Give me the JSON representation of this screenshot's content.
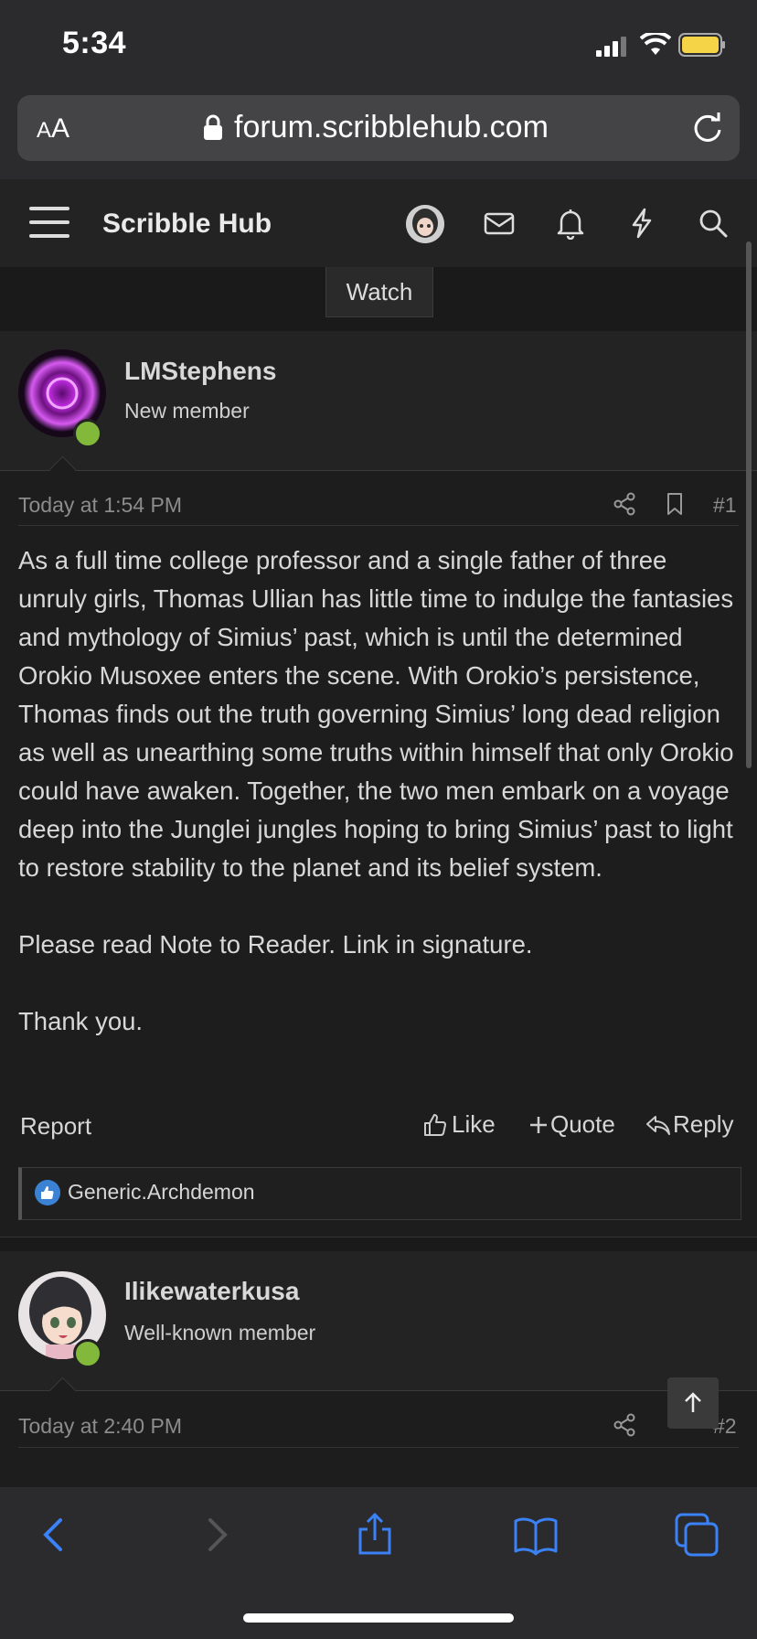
{
  "status": {
    "time": "5:34"
  },
  "browser": {
    "aa_label_small": "A",
    "aa_label_large": "A",
    "url": "forum.scribblehub.com"
  },
  "forum": {
    "site_title": "Scribble Hub",
    "watch_label": "Watch"
  },
  "posts": [
    {
      "username": "LMStephens",
      "user_title": "New member",
      "timestamp": "Today at 1:54 PM",
      "post_number": "#1",
      "body": [
        "As a full time college professor and a single father of three unruly girls, Thomas Ullian has little time to indulge the fantasies and mythology of Simius’ past, which is until the determined Orokio Musoxee enters the scene. With Orokio’s persistence, Thomas finds out the truth governing Simius’ long dead religion as well as unearthing some truths within himself that only Orokio could have awaken. Together, the two men embark on a voyage deep into the Junglei jungles hoping to bring Simius’ past to light to restore stability to the planet and its belief system.",
        "Please read Note to Reader. Link in signature.",
        "Thank you."
      ],
      "actions": {
        "report": "Report",
        "like": "Like",
        "quote": "Quote",
        "reply": "Reply"
      },
      "liked_by": "Generic.Archdemon"
    },
    {
      "username": "Ilikewaterkusa",
      "user_title": "Well-known member",
      "timestamp": "Today at 2:40 PM",
      "post_number": "#2"
    }
  ],
  "colors": {
    "online": "#82b93b",
    "like_badge": "#3b82d4",
    "toolbar_accent": "#3b82f6"
  },
  "icons": [
    "menu-icon",
    "mail-icon",
    "bell-icon",
    "bolt-icon",
    "search-icon",
    "share-icon",
    "bookmark-icon",
    "thumbs-up-icon",
    "plus-icon",
    "reply-icon",
    "arrow-up-icon",
    "back-icon",
    "forward-icon",
    "share-sheet-icon",
    "bookmarks-icon",
    "tabs-icon"
  ]
}
